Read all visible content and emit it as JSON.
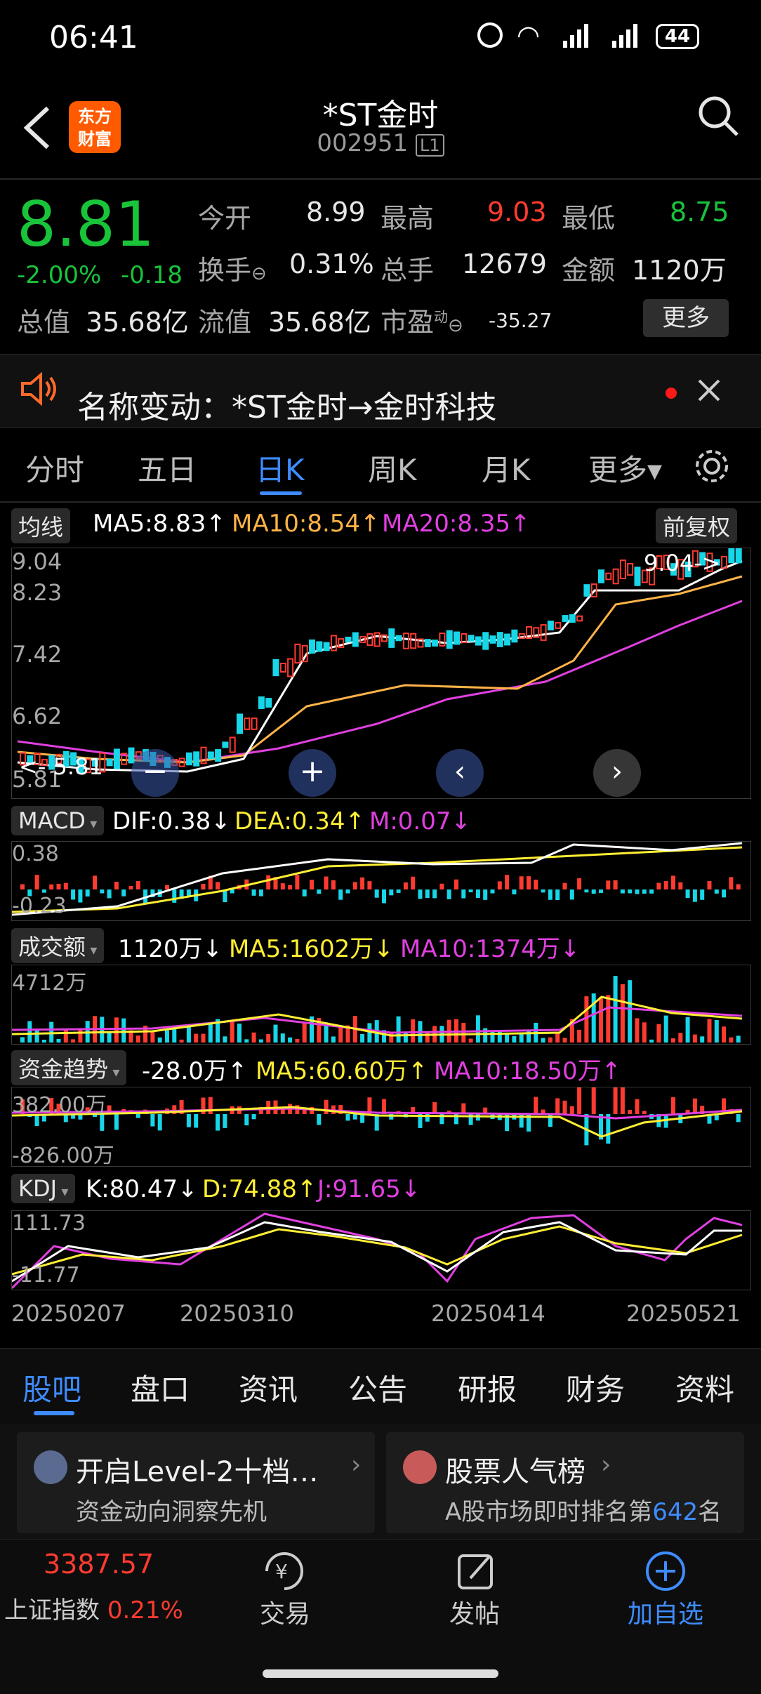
{
  "status": {
    "time": "06:41",
    "battery": "44"
  },
  "header": {
    "logo_line1": "东方",
    "logo_line2": "财富",
    "title": "*ST金时",
    "code": "002951",
    "level": "L1"
  },
  "quote": {
    "price": "8.81",
    "pct": "-2.00%",
    "chg": "-0.18",
    "open_label": "今开",
    "open": "8.99",
    "high_label": "最高",
    "high": "9.03",
    "low_label": "最低",
    "low": "8.75",
    "turnover_label": "换手",
    "turnover": "0.31%",
    "volume_label": "总手",
    "volume": "12679",
    "amount_label": "金额",
    "amount": "1120万",
    "total_label": "总值",
    "total": "35.68亿",
    "float_label": "流值",
    "float": "35.68亿",
    "pe_label": "市盈",
    "pe_sup": "动",
    "pe": "-35.27",
    "more": "更多"
  },
  "notice": {
    "text": "名称变动：*ST金时→金时科技"
  },
  "period_tabs": [
    "分时",
    "五日",
    "日K",
    "周K",
    "月K",
    "更多▾"
  ],
  "ma_bar": {
    "tag": "均线",
    "ma5": "MA5:8.83↑",
    "ma10": "MA10:8.54↑",
    "ma20": "MA20:8.35↑",
    "adj": "前复权"
  },
  "kline": {
    "y_labels": [
      "9.04",
      "8.23",
      "7.42",
      "6.62",
      "5.81"
    ],
    "max_label": "9.04->",
    "min_label": "<- 5.81"
  },
  "macd": {
    "tag": "MACD",
    "dif": "DIF:0.38↓",
    "dea": "DEA:0.34↑",
    "m": "M:0.07↓",
    "top": "0.38",
    "bottom": "-0.23"
  },
  "vol": {
    "tag": "成交额",
    "v": "1120万↓",
    "ma5": "MA5:1602万↓",
    "ma10": "MA10:1374万↓",
    "top": "4712万"
  },
  "fund": {
    "tag": "资金趋势",
    "v": "-28.0万↑",
    "ma5": "MA5:60.60万↑",
    "ma10": "MA10:18.50万↑",
    "top": "382.00万",
    "bottom": "-826.00万"
  },
  "kdj": {
    "tag": "KDJ",
    "k": "K:80.47↓",
    "d": "D:74.88↑",
    "j": "J:91.65↓",
    "top": "111.73",
    "bottom": "-11.77"
  },
  "dates": [
    "20250207",
    "20250310",
    "20250414",
    "20250521"
  ],
  "bottom_tabs": [
    "股吧",
    "盘口",
    "资讯",
    "公告",
    "研报",
    "财务",
    "资料"
  ],
  "cards": [
    {
      "title": "开启Level-2十档…",
      "sub": "资金动向洞察先机"
    },
    {
      "title": "股票人气榜",
      "sub_pre": "A股市场即时排名第",
      "rank": "642",
      "sub_post": "名"
    }
  ],
  "nav": {
    "index_value": "3387.57",
    "index_name": "上证指数",
    "index_pct": "0.21%",
    "trade": "交易",
    "post": "发帖",
    "add": "加自选"
  },
  "colors": {
    "up": "#ff3b30",
    "down": "#19c43b",
    "accent": "#3e8cff",
    "ma10": "#ffb347",
    "ma20": "#e040e0"
  }
}
